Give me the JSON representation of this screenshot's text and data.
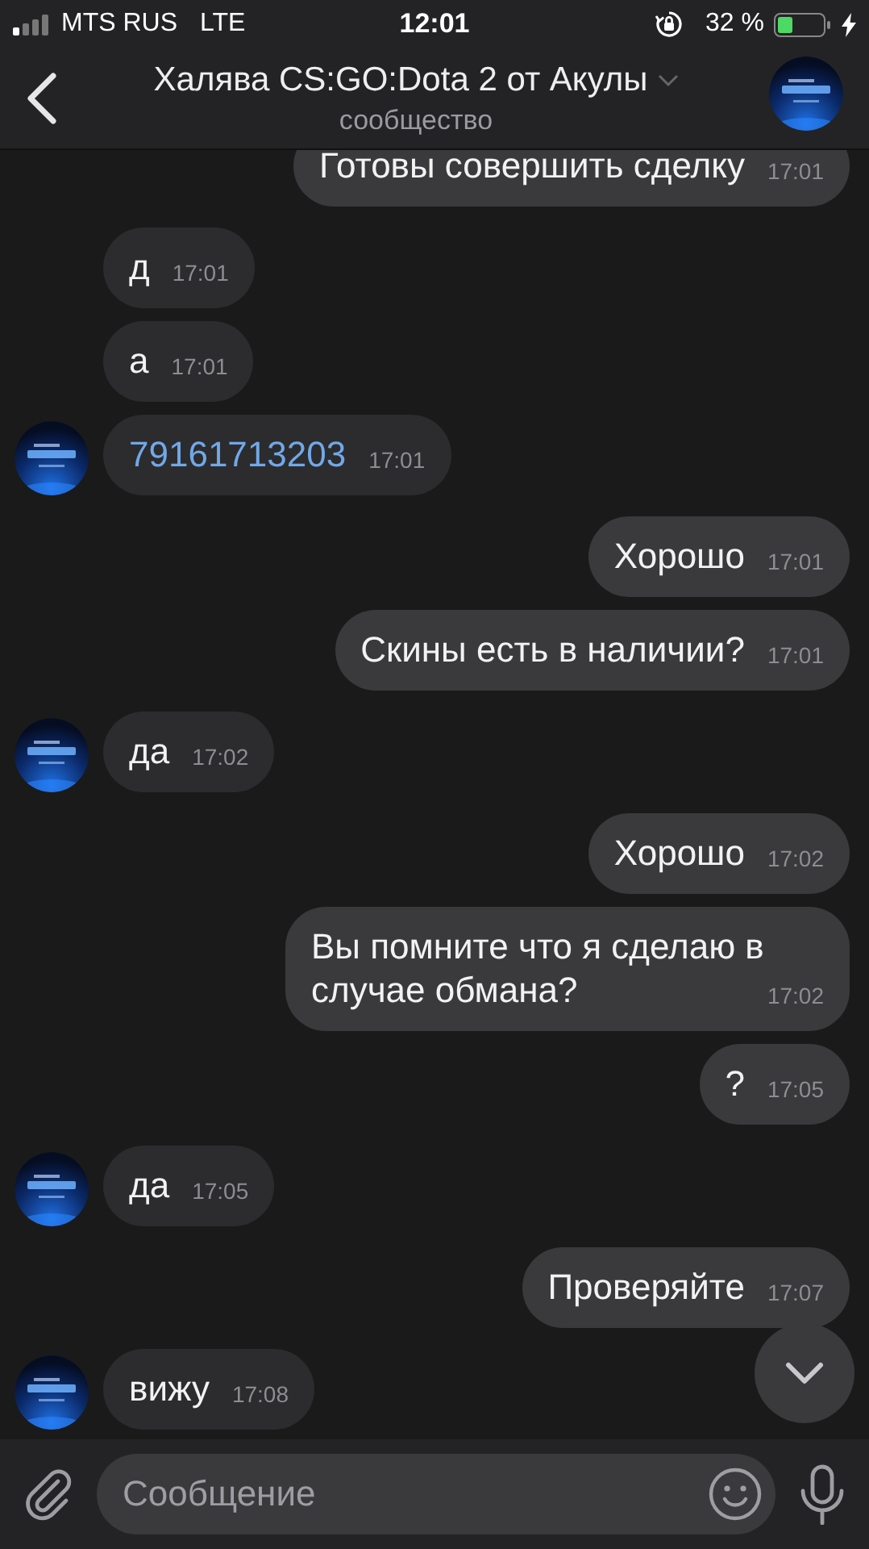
{
  "status_bar": {
    "carrier": "MTS RUS",
    "network": "LTE",
    "time": "12:01",
    "battery": "32 %"
  },
  "header": {
    "title": "Халява CS:GO:Dota 2 от Акулы",
    "subtitle": "сообщество"
  },
  "messages": [
    {
      "outgoing": true,
      "kind": "text",
      "text": "Готовы совершить сделку",
      "time": "17:01",
      "avatar": false
    },
    {
      "outgoing": false,
      "kind": "text",
      "text": "д",
      "time": "17:01",
      "avatar": false
    },
    {
      "outgoing": false,
      "kind": "text",
      "text": "а",
      "time": "17:01",
      "avatar": false
    },
    {
      "outgoing": false,
      "kind": "phone",
      "text": "79161713203",
      "time": "17:01",
      "avatar": true
    },
    {
      "outgoing": true,
      "kind": "text",
      "text": "Хорошо",
      "time": "17:01",
      "avatar": false
    },
    {
      "outgoing": true,
      "kind": "text",
      "text": "Скины есть в наличии?",
      "time": "17:01",
      "avatar": false
    },
    {
      "outgoing": false,
      "kind": "text",
      "text": "да",
      "time": "17:02",
      "avatar": true
    },
    {
      "outgoing": true,
      "kind": "text",
      "text": "Хорошо",
      "time": "17:02",
      "avatar": false
    },
    {
      "outgoing": true,
      "kind": "text",
      "text": "Вы помните что я сделаю в случае обмана?",
      "time": "17:02",
      "avatar": false
    },
    {
      "outgoing": true,
      "kind": "text",
      "text": "?",
      "time": "17:05",
      "avatar": false
    },
    {
      "outgoing": false,
      "kind": "text",
      "text": "да",
      "time": "17:05",
      "avatar": true
    },
    {
      "outgoing": true,
      "kind": "text",
      "text": "Проверяйте",
      "time": "17:07",
      "avatar": false
    },
    {
      "outgoing": false,
      "kind": "text",
      "text": "вижу",
      "time": "17:08",
      "avatar": true
    }
  ],
  "composer": {
    "placeholder": "Сообщение"
  }
}
